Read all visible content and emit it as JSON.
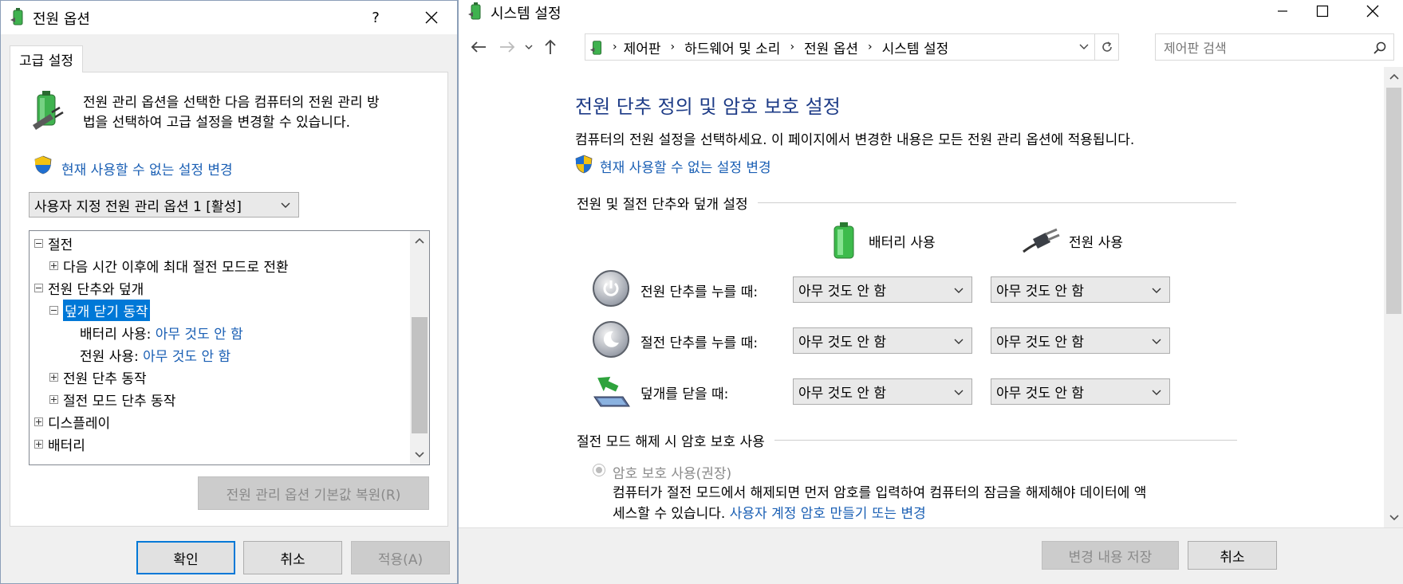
{
  "left_window": {
    "title": "전원 옵션",
    "help_label": "?",
    "tab_label": "고급 설정",
    "description": "전원 관리 옵션을 선택한 다음 컴퓨터의 전원 관리 방법을 선택하여 고급 설정을 변경할 수 있습니다.",
    "description_line1": "전원 관리 옵션을 선택한 다음 컴퓨터의 전원 관리 방",
    "description_line2": "법을 선택하여 고급 설정을 변경할 수 있습니다.",
    "change_link": "현재 사용할 수 없는 설정 변경",
    "plan_select": "사용자 지정 전원 관리 옵션 1 [활성]",
    "tree": {
      "sleep": "절전",
      "hibernate_after": "다음 시간 이후에 최대 절전 모드로 전환",
      "buttons_lid": "전원 단추와 덮개",
      "lid_close_action": "덮개 닫기 동작",
      "battery_label": "배터리 사용:",
      "battery_value": "아무 것도 안 함",
      "plugged_label": "전원 사용:",
      "plugged_value": "아무 것도 안 함",
      "power_button_action": "전원 단추 동작",
      "sleep_button_action": "절전 모드 단추 동작",
      "display": "디스플레이",
      "battery": "배터리"
    },
    "restore_button": "전원 관리 옵션 기본값 복원(R)",
    "ok_button": "확인",
    "cancel_button": "취소",
    "apply_button": "적용(A)"
  },
  "right_window": {
    "title": "시스템 설정",
    "breadcrumb": [
      "제어판",
      "하드웨어 및 소리",
      "전원 옵션",
      "시스템 설정"
    ],
    "search_placeholder": "제어판 검색",
    "heading": "전원 단추 정의 및 암호 보호 설정",
    "subtitle": "컴퓨터의 전원 설정을 선택하세요. 이 페이지에서 변경한 내용은 모든 전원 관리 옵션에 적용됩니다.",
    "change_link": "현재 사용할 수 없는 설정 변경",
    "section1_title": "전원 및 절전 단추와 덮개 설정",
    "col_battery": "배터리 사용",
    "col_plugged": "전원 사용",
    "rows": [
      {
        "label": "전원 단추를 누를 때:",
        "battery": "아무 것도 안 함",
        "plugged": "아무 것도 안 함"
      },
      {
        "label": "절전 단추를 누를 때:",
        "battery": "아무 것도 안 함",
        "plugged": "아무 것도 안 함"
      },
      {
        "label": "덮개를 닫을 때:",
        "battery": "아무 것도 안 함",
        "plugged": "아무 것도 안 함"
      }
    ],
    "section2_title": "절전 모드 해제 시 암호 보호 사용",
    "password_option": "암호 보호 사용(권장)",
    "password_desc_line1": "컴퓨터가 절전 모드에서 해제되면 먼저 암호를 입력하여 컴퓨터의 잠금을 해제해야 데이터에 액",
    "password_desc_line2_prefix": "세스할 수 있습니다.",
    "password_link": "사용자 계정 암호 만들기 또는 변경",
    "save_button": "변경 내용 저장",
    "cancel_button": "취소"
  },
  "colors": {
    "link": "#1a5fb4",
    "heading": "#1e3c87",
    "selection": "#0078d7",
    "dialog_bg": "#f0f0f0"
  }
}
